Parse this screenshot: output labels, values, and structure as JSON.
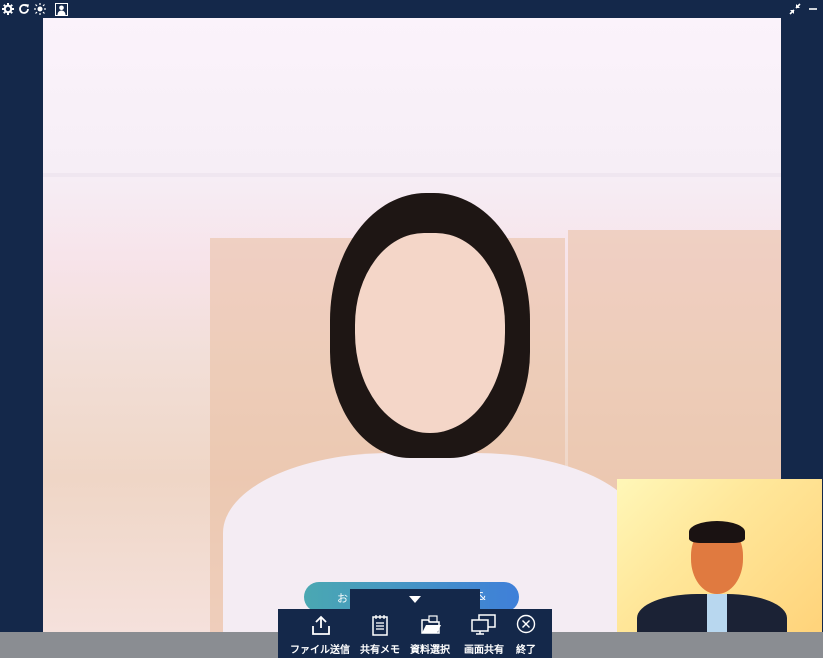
{
  "topbar": {
    "left_icons": [
      "gear-icon",
      "refresh-icon",
      "brightness-icon",
      "person-icon"
    ],
    "right_icons": [
      "minimize-arrows-icon",
      "minimize-icon"
    ]
  },
  "overlay_pill": {
    "left_text": "お",
    "right_text": "&"
  },
  "toolbar": {
    "items": [
      {
        "label": "ファイル送信",
        "icon": "upload-icon"
      },
      {
        "label": "共有メモ",
        "icon": "notepad-icon"
      },
      {
        "label": "資料選択",
        "icon": "folder-icon"
      },
      {
        "label": "画面共有",
        "icon": "screen-share-icon"
      },
      {
        "label": "終了",
        "icon": "close-circle-icon"
      }
    ]
  },
  "colors": {
    "frame": "#14284a",
    "pill_start": "#4aa8b2",
    "pill_end": "#3f7fd9",
    "bottom_strip": "#8a8d92"
  }
}
